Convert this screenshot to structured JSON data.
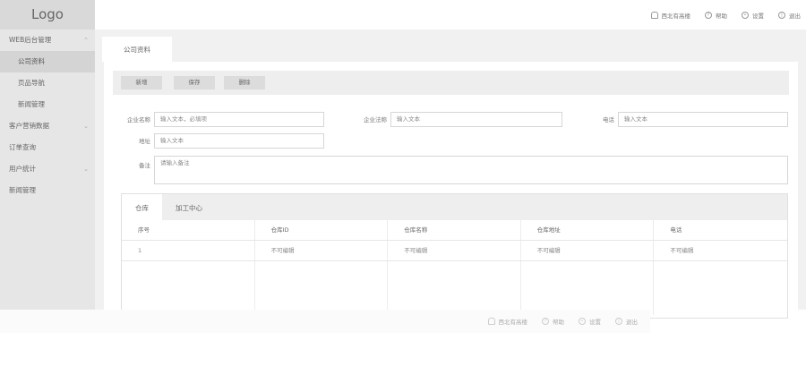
{
  "logo": "Logo",
  "sidebar": {
    "items": [
      {
        "label": "WEB后台管理",
        "chev": "⌃"
      },
      {
        "label": "公司资料"
      },
      {
        "label": "页品导航"
      },
      {
        "label": "新闻管理"
      },
      {
        "label": "客户营销数据",
        "chev": "⌄"
      },
      {
        "label": "订单查询"
      },
      {
        "label": "用户统计",
        "chev": "⌄"
      },
      {
        "label": "新闻管理"
      }
    ]
  },
  "topbar": {
    "user": "西北有高楼",
    "help": "帮助",
    "settings": "设置",
    "logout": "退出"
  },
  "main": {
    "tab": "公司资料",
    "buttons": {
      "add": "新增",
      "save": "保存",
      "delete": "删除"
    },
    "form": {
      "company_name_label": "企业名称",
      "company_name_placeholder": "输入文本，必填项",
      "contact_label": "企业法称",
      "contact_placeholder": "输入文本",
      "phone_label": "电话",
      "phone_placeholder": "输入文本",
      "address_label": "地址",
      "address_placeholder": "输入文本",
      "remark_label": "备注",
      "remark_placeholder": "请输入备注"
    },
    "table": {
      "tabs": [
        "仓库",
        "加工中心"
      ],
      "headers": [
        "序号",
        "仓库ID",
        "仓库名称",
        "仓库地址",
        "电话"
      ],
      "rows": [
        [
          "1",
          "不可编辑",
          "不可编辑",
          "不可编辑",
          "不可编辑"
        ]
      ]
    }
  },
  "floatbar": {
    "user": "西北有高楼",
    "help": "帮助",
    "settings": "设置",
    "logout": "退出"
  }
}
